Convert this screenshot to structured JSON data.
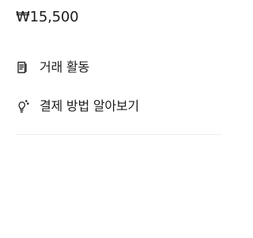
{
  "price": {
    "value": "₩15,500"
  },
  "menu": {
    "items": [
      {
        "label": "거래 활동",
        "icon": "document-icon"
      },
      {
        "label": "결제 방법 알아보기",
        "icon": "lightbulb-icon"
      }
    ]
  },
  "colors": {
    "text": "#1c1c1e",
    "icon": "#2c2c2e",
    "divider": "#eeeeef",
    "background": "#ffffff"
  }
}
